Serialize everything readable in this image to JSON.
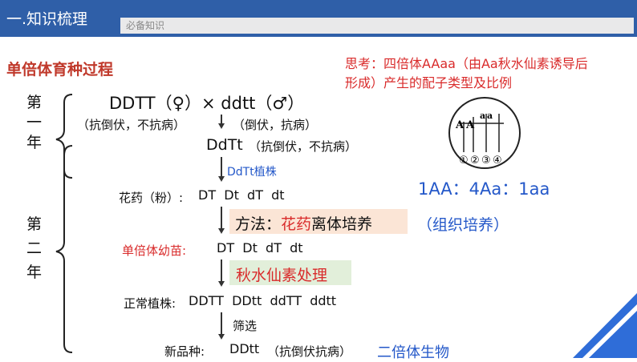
{
  "header": {
    "title": "一.知识梳理",
    "subtitle": "必备知识"
  },
  "section_title": "单倍体育种过程",
  "think": {
    "line1": "思考：四倍体AAaa（由Aa秋水仙素诱导后",
    "line2": "形成）产生的配子类型及比例"
  },
  "stages": {
    "first": [
      "第",
      "一",
      "年"
    ],
    "second": [
      "第",
      "二",
      "年"
    ]
  },
  "cross": {
    "parents": "DDTT（♀）× ddtt（♂）",
    "left_trait": "（抗倒伏，不抗病）",
    "right_trait": "（倒伏，抗病）",
    "f1": "DdTt",
    "f1_trait": "（抗倒伏，不抗病）",
    "f1_plant": "DdTt植株"
  },
  "pollen": {
    "label": "花药（粉）: ",
    "values": "DT  Dt  dT  dt"
  },
  "method": {
    "prefix": "方法：",
    "highlight": "花药",
    "suffix": "离体培养",
    "note": "（组织培养）"
  },
  "haploid": {
    "label": "单倍体幼苗:",
    "values": "DT  Dt  dT  dt"
  },
  "colchicine": "秋水仙素处理",
  "normal": {
    "label": "正常植株: ",
    "values": "DDTT  DDtt  ddTT  ddtt"
  },
  "screen": "筛选",
  "new_variety": {
    "label": "新品种: ",
    "value": "DDtt",
    "trait": "（抗倒伏抗病）",
    "note": "二倍体生物"
  },
  "diagram": {
    "alleles": [
      "A",
      "A",
      "a",
      "a"
    ],
    "numbers": [
      "①",
      "②",
      "③",
      "④"
    ]
  },
  "ratio": "1AA：4Aa：1aa",
  "colors": {
    "header_bg": "#2f5fa8",
    "red": "#d92b2b",
    "blue": "#2458c9",
    "method_bg": "#fbe5d6",
    "colchicine_bg": "#e2efda"
  }
}
